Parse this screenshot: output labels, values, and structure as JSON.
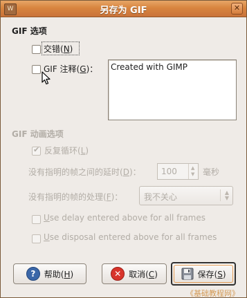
{
  "window": {
    "title": "另存为 GIF",
    "menu_icon": "gimp-icon",
    "close_glyph": "✕"
  },
  "gif_options": {
    "heading": "GIF 选项",
    "interlace": {
      "label_pre": "交错(",
      "mnemonic": "N",
      "label_post": ")",
      "checked": false
    },
    "comment": {
      "label_pre": "GIF 注释(",
      "mnemonic": "G",
      "label_post": ")：",
      "checked": false,
      "value": "Created with GIMP"
    }
  },
  "animation_options": {
    "heading": "GIF 动画选项",
    "loop": {
      "label_pre": "反复循环(",
      "mnemonic": "L",
      "label_post": ")",
      "checked": true
    },
    "delay": {
      "label_pre": "没有指明的帧之间的延时(",
      "mnemonic": "D",
      "label_post": ")：",
      "value": "100",
      "unit": "毫秒"
    },
    "disposal": {
      "label_pre": "没有指明的帧的处理(",
      "mnemonic": "F",
      "label_post": ")：",
      "value": "我不关心"
    },
    "use_delay": {
      "mnemonic": "U",
      "label_post": "se delay entered above for all frames",
      "checked": false
    },
    "use_disposal": {
      "mnemonic": "U",
      "label_post": "se disposal entered above for all frames",
      "checked": false
    }
  },
  "buttons": {
    "help": {
      "label_pre": "帮助(",
      "mnemonic": "H",
      "label_post": ")"
    },
    "cancel": {
      "label_pre": "取消(",
      "mnemonic": "C",
      "label_post": ")"
    },
    "save": {
      "label_pre": "保存(",
      "mnemonic": "S",
      "label_post": ")"
    }
  },
  "watermark": "《基础教程网》",
  "colors": {
    "titlebar": "#d8853f",
    "background": "#efebe7",
    "disabled_text": "#b2ada6"
  }
}
